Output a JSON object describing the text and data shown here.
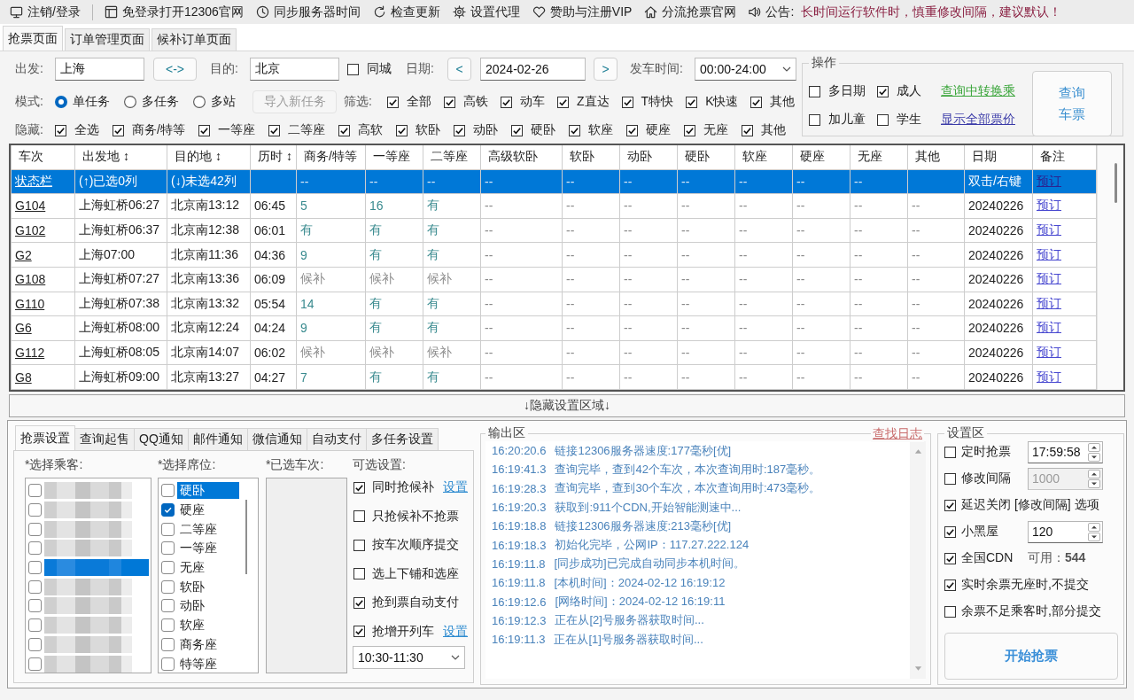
{
  "toolbar": {
    "items": [
      "注销/登录",
      "免登录打开12306官网",
      "同步服务器时间",
      "检查更新",
      "设置代理",
      "赞助与注册VIP",
      "分流抢票官网"
    ],
    "notice_label": "公告:",
    "notice": "长时间运行软件时，慎重修改间隔，建议默认！"
  },
  "page_tabs": [
    {
      "label": "抢票页面",
      "selected": true
    },
    {
      "label": "订单管理页面",
      "selected": false
    },
    {
      "label": "候补订单页面",
      "selected": false
    }
  ],
  "query": {
    "from_label": "出发:",
    "from_value": "上海",
    "swap_button": "<->",
    "to_label": "目的:",
    "to_value": "北京",
    "same_city": {
      "label": "同城",
      "checked": false
    },
    "date_label": "日期:",
    "prev_button": "<",
    "date_value": "2024-02-26",
    "next_button": ">",
    "time_label": "发车时间:",
    "time_value": "00:00-24:00"
  },
  "mode": {
    "label": "模式:",
    "options": [
      {
        "label": "单任务",
        "selected": true
      },
      {
        "label": "多任务",
        "selected": false
      },
      {
        "label": "多站",
        "selected": false
      }
    ],
    "import_button": {
      "label": "导入新任务",
      "disabled": true
    }
  },
  "filter": {
    "label": "筛选:",
    "options": [
      {
        "label": "全部",
        "checked": true
      },
      {
        "label": "高铁",
        "checked": true
      },
      {
        "label": "动车",
        "checked": true
      },
      {
        "label": "Z直达",
        "checked": true
      },
      {
        "label": "T特快",
        "checked": true
      },
      {
        "label": "K快速",
        "checked": true
      },
      {
        "label": "其他",
        "checked": true
      }
    ]
  },
  "hide": {
    "label": "隐藏:",
    "options": [
      {
        "label": "全选",
        "checked": true
      },
      {
        "label": "商务/特等",
        "checked": true
      },
      {
        "label": "一等座",
        "checked": true
      },
      {
        "label": "二等座",
        "checked": true
      },
      {
        "label": "高软",
        "checked": true
      },
      {
        "label": "软卧",
        "checked": true
      },
      {
        "label": "动卧",
        "checked": true
      },
      {
        "label": "硬卧",
        "checked": true
      },
      {
        "label": "软座",
        "checked": true
      },
      {
        "label": "硬座",
        "checked": true
      },
      {
        "label": "无座",
        "checked": true
      },
      {
        "label": "其他",
        "checked": true
      }
    ]
  },
  "operations": {
    "title": "操作",
    "rows": [
      {
        "options": [
          {
            "label": "多日期",
            "checked": false
          },
          {
            "label": "成人",
            "checked": true
          }
        ],
        "link": {
          "text": "查询中转换乘",
          "color": "#3aa53a"
        }
      },
      {
        "options": [
          {
            "label": "加儿童",
            "checked": false
          },
          {
            "label": "学生",
            "checked": false
          }
        ],
        "link": {
          "text": "显示全部票价",
          "color": "#3b3ba8"
        }
      }
    ],
    "query_button": "查询车票"
  },
  "table": {
    "columns": [
      "车次",
      "出发地 ↕",
      "目的地 ↕",
      "历时 ↕",
      "商务/特等",
      "一等座",
      "二等座",
      "高级软卧",
      "软卧",
      "动卧",
      "硬卧",
      "软座",
      "硬座",
      "无座",
      "其他",
      "日期",
      "备注"
    ],
    "rows": [
      {
        "selected": true,
        "train": "状态栏",
        "from": "(↑)已选0列",
        "to": "(↓)未选42列",
        "seats": [
          {
            "text": "--"
          },
          {
            "text": "--"
          },
          {
            "text": "--"
          },
          {
            "text": "--"
          },
          {
            "text": "--"
          },
          {
            "text": "--"
          },
          {
            "text": "--"
          },
          {
            "text": "--"
          },
          {
            "text": "--"
          },
          {
            "text": "--"
          }
        ],
        "date": "双击/右键",
        "note": "预订"
      },
      {
        "selected": false,
        "train": "G104",
        "from": "上海虹桥06:27",
        "to": "北京南13:12",
        "duration": "06:45",
        "seats": [
          {
            "text": "5",
            "available": true
          },
          {
            "text": "16",
            "available": true
          },
          {
            "text": "有",
            "available": true
          },
          {
            "text": "--",
            "available": false
          },
          {
            "text": "--",
            "available": false
          },
          {
            "text": "--",
            "available": false
          },
          {
            "text": "--",
            "available": false
          },
          {
            "text": "--",
            "available": false
          },
          {
            "text": "--",
            "available": false
          },
          {
            "text": "--",
            "available": false
          },
          {
            "text": "--",
            "available": false
          }
        ],
        "date": "20240226",
        "note": "预订"
      },
      {
        "selected": false,
        "train": "G102",
        "from": "上海虹桥06:37",
        "to": "北京南12:38",
        "duration": "06:01",
        "seats": [
          {
            "text": "有",
            "available": true
          },
          {
            "text": "有",
            "available": true
          },
          {
            "text": "有",
            "available": true
          },
          {
            "text": "--",
            "available": false
          },
          {
            "text": "--",
            "available": false
          },
          {
            "text": "--",
            "available": false
          },
          {
            "text": "--",
            "available": false
          },
          {
            "text": "--",
            "available": false
          },
          {
            "text": "--",
            "available": false
          },
          {
            "text": "--",
            "available": false
          },
          {
            "text": "--",
            "available": false
          }
        ],
        "date": "20240226",
        "note": "预订"
      },
      {
        "selected": false,
        "train": "G2",
        "from": "上海07:00",
        "to": "北京南11:36",
        "duration": "04:36",
        "seats": [
          {
            "text": "9",
            "available": true
          },
          {
            "text": "有",
            "available": true
          },
          {
            "text": "有",
            "available": true
          },
          {
            "text": "--",
            "available": false
          },
          {
            "text": "--",
            "available": false
          },
          {
            "text": "--",
            "available": false
          },
          {
            "text": "--",
            "available": false
          },
          {
            "text": "--",
            "available": false
          },
          {
            "text": "--",
            "available": false
          },
          {
            "text": "--",
            "available": false
          },
          {
            "text": "--",
            "available": false
          }
        ],
        "date": "20240226",
        "note": "预订"
      },
      {
        "selected": false,
        "train": "G108",
        "from": "上海虹桥07:27",
        "to": "北京南13:36",
        "duration": "06:09",
        "seats": [
          {
            "text": "候补",
            "available": false
          },
          {
            "text": "候补",
            "available": false
          },
          {
            "text": "候补",
            "available": false
          },
          {
            "text": "--",
            "available": false
          },
          {
            "text": "--",
            "available": false
          },
          {
            "text": "--",
            "available": false
          },
          {
            "text": "--",
            "available": false
          },
          {
            "text": "--",
            "available": false
          },
          {
            "text": "--",
            "available": false
          },
          {
            "text": "--",
            "available": false
          },
          {
            "text": "--",
            "available": false
          }
        ],
        "date": "20240226",
        "note": "预订"
      },
      {
        "selected": false,
        "train": "G110",
        "from": "上海虹桥07:38",
        "to": "北京南13:32",
        "duration": "05:54",
        "seats": [
          {
            "text": "14",
            "available": true
          },
          {
            "text": "有",
            "available": true
          },
          {
            "text": "有",
            "available": true
          },
          {
            "text": "--",
            "available": false
          },
          {
            "text": "--",
            "available": false
          },
          {
            "text": "--",
            "available": false
          },
          {
            "text": "--",
            "available": false
          },
          {
            "text": "--",
            "available": false
          },
          {
            "text": "--",
            "available": false
          },
          {
            "text": "--",
            "available": false
          },
          {
            "text": "--",
            "available": false
          }
        ],
        "date": "20240226",
        "note": "预订"
      },
      {
        "selected": false,
        "train": "G6",
        "from": "上海虹桥08:00",
        "to": "北京南12:24",
        "duration": "04:24",
        "seats": [
          {
            "text": "9",
            "available": true
          },
          {
            "text": "有",
            "available": true
          },
          {
            "text": "有",
            "available": true
          },
          {
            "text": "--",
            "available": false
          },
          {
            "text": "--",
            "available": false
          },
          {
            "text": "--",
            "available": false
          },
          {
            "text": "--",
            "available": false
          },
          {
            "text": "--",
            "available": false
          },
          {
            "text": "--",
            "available": false
          },
          {
            "text": "--",
            "available": false
          },
          {
            "text": "--",
            "available": false
          }
        ],
        "date": "20240226",
        "note": "预订"
      },
      {
        "selected": false,
        "train": "G112",
        "from": "上海虹桥08:05",
        "to": "北京南14:07",
        "duration": "06:02",
        "seats": [
          {
            "text": "候补",
            "available": false
          },
          {
            "text": "候补",
            "available": false
          },
          {
            "text": "候补",
            "available": false
          },
          {
            "text": "--",
            "available": false
          },
          {
            "text": "--",
            "available": false
          },
          {
            "text": "--",
            "available": false
          },
          {
            "text": "--",
            "available": false
          },
          {
            "text": "--",
            "available": false
          },
          {
            "text": "--",
            "available": false
          },
          {
            "text": "--",
            "available": false
          },
          {
            "text": "--",
            "available": false
          }
        ],
        "date": "20240226",
        "note": "预订"
      },
      {
        "selected": false,
        "train": "G8",
        "from": "上海虹桥09:00",
        "to": "北京南13:27",
        "duration": "04:27",
        "seats": [
          {
            "text": "7",
            "available": true
          },
          {
            "text": "有",
            "available": true
          },
          {
            "text": "有",
            "available": true
          },
          {
            "text": "--",
            "available": false
          },
          {
            "text": "--",
            "available": false
          },
          {
            "text": "--",
            "available": false
          },
          {
            "text": "--",
            "available": false
          },
          {
            "text": "--",
            "available": false
          },
          {
            "text": "--",
            "available": false
          },
          {
            "text": "--",
            "available": false
          },
          {
            "text": "--",
            "available": false
          }
        ],
        "date": "20240226",
        "note": "预订"
      }
    ]
  },
  "toggle_bar": "↓隐藏设置区域↓",
  "settings_tabs": [
    {
      "label": "抢票设置",
      "selected": true
    },
    {
      "label": "查询起售",
      "selected": false
    },
    {
      "label": "QQ通知",
      "selected": false
    },
    {
      "label": "邮件通知",
      "selected": false
    },
    {
      "label": "微信通知",
      "selected": false
    },
    {
      "label": "自动支付",
      "selected": false
    },
    {
      "label": "多任务设置",
      "selected": false
    }
  ],
  "ticket_settings": {
    "passengers": {
      "label": "*选择乘客:",
      "items": [
        {
          "checked": false,
          "selected": false
        },
        {
          "checked": false,
          "selected": false
        },
        {
          "checked": false,
          "selected": false
        },
        {
          "checked": false,
          "selected": false
        },
        {
          "checked": false,
          "selected": true
        },
        {
          "checked": false,
          "selected": false
        },
        {
          "checked": false,
          "selected": false
        },
        {
          "checked": false,
          "selected": false
        },
        {
          "checked": false,
          "selected": false
        },
        {
          "checked": false,
          "selected": false
        }
      ]
    },
    "seats": {
      "label": "*选择席位:",
      "items": [
        {
          "label": "硬卧",
          "checked": false,
          "selected": true
        },
        {
          "label": "硬座",
          "checked": true,
          "selected": false
        },
        {
          "label": "二等座",
          "checked": false,
          "selected": false
        },
        {
          "label": "一等座",
          "checked": false,
          "selected": false
        },
        {
          "label": "无座",
          "checked": false,
          "selected": false
        },
        {
          "label": "软卧",
          "checked": false,
          "selected": false
        },
        {
          "label": "动卧",
          "checked": false,
          "selected": false
        },
        {
          "label": "软座",
          "checked": false,
          "selected": false
        },
        {
          "label": "商务座",
          "checked": false,
          "selected": false
        },
        {
          "label": "特等座",
          "checked": false,
          "selected": false
        }
      ]
    },
    "selected_trains": {
      "label": "*已选车次:"
    },
    "options": {
      "label": "可选设置:",
      "items": [
        {
          "label": "同时抢候补",
          "checked": true,
          "link": "设置"
        },
        {
          "label": "只抢候补不抢票",
          "checked": false
        },
        {
          "label": "按车次顺序提交",
          "checked": false
        },
        {
          "label": "选上下铺和选座",
          "checked": false
        },
        {
          "label": "抢到票自动支付",
          "checked": true
        },
        {
          "label": "抢增开列车",
          "checked": true,
          "link": "设置"
        }
      ]
    },
    "time_range": "10:30-11:30"
  },
  "output": {
    "title": "输出区",
    "log_link": "查找日志",
    "lines": [
      {
        "time": "16:20:20.6",
        "text": "链接12306服务器速度:177毫秒[优]"
      },
      {
        "time": "16:19:41.3",
        "text": "查询完毕，查到42个车次，本次查询用时:187毫秒。"
      },
      {
        "time": "16:19:28.3",
        "text": "查询完毕，查到30个车次，本次查询用时:473毫秒。"
      },
      {
        "time": "16:19:20.3",
        "text": "获取到:911个CDN,开始智能测速中..."
      },
      {
        "time": "16:19:18.8",
        "text": "链接12306服务器速度:213毫秒[优]"
      },
      {
        "time": "16:19:18.3",
        "text": "初始化完毕，公网IP：117.27.222.124"
      },
      {
        "time": "16:19:11.8",
        "text": "[同步成功]已完成自动同步本机时间。"
      },
      {
        "time": "16:19:11.8",
        "text": "[本机时间]：2024-02-12 16:19:12"
      },
      {
        "time": "16:19:12.6",
        "text": "[网络时间]：2024-02-12 16:19:11"
      },
      {
        "time": "16:19:12.3",
        "text": "正在从[2]号服务器获取时间..."
      },
      {
        "time": "16:19:11.3",
        "text": "正在从[1]号服务器获取时间..."
      }
    ]
  },
  "settings": {
    "title": "设置区",
    "rows": [
      {
        "kind": "spin",
        "label": "定时抢票",
        "checked": false,
        "value": "17:59:58",
        "disabled": false
      },
      {
        "kind": "spin",
        "label": "修改间隔",
        "checked": false,
        "value": "1000",
        "disabled": true
      },
      {
        "kind": "check",
        "label": "延迟关闭 [修改间隔] 选项",
        "checked": true
      },
      {
        "kind": "spin",
        "label": "小黑屋",
        "checked": true,
        "value": "120",
        "disabled": false
      },
      {
        "kind": "info",
        "label": "全国CDN",
        "checked": true,
        "info": "可用：**544**"
      },
      {
        "kind": "check",
        "label": "实时余票无座时,不提交",
        "checked": true
      },
      {
        "kind": "check",
        "label": "余票不足乘客时,部分提交",
        "checked": false
      }
    ],
    "start_button": "开始抢票"
  }
}
